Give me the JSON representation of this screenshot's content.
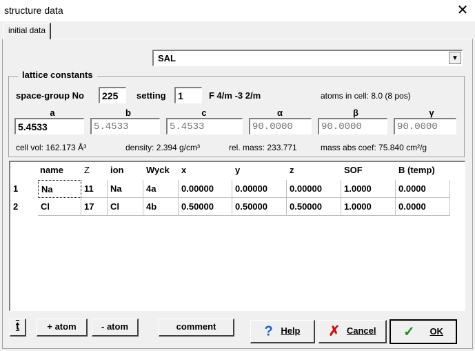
{
  "window": {
    "title": "structure data",
    "close_glyph": "✕"
  },
  "tabs": [
    {
      "label": "initial data"
    }
  ],
  "compound": {
    "value": "SAL",
    "arrow": "▼"
  },
  "lattice": {
    "label": "lattice constants",
    "space_group_label": "space-group No",
    "space_group_value": "225",
    "setting_label": "setting",
    "setting_value": "1",
    "hm_symbol": "F 4/m -3 2/m",
    "atoms_in_cell": "atoms in cell: 8.0  (8 pos)",
    "params": [
      {
        "label": "a",
        "value": "5.4533"
      },
      {
        "label": "b",
        "value": "5.4533"
      },
      {
        "label": "c",
        "value": "5.4533"
      },
      {
        "label": "α",
        "value": "90.0000"
      },
      {
        "label": "β",
        "value": "90.0000"
      },
      {
        "label": "γ",
        "value": "90.0000"
      }
    ],
    "cell_vol": "cell vol: 162.173 Å³",
    "density": "density: 2.394 g/cm³",
    "rel_mass": "rel. mass: 233.771",
    "mass_abs": "mass abs coef: 75.840 cm²/g"
  },
  "atoms": {
    "columns": [
      "name",
      "Z",
      "ion",
      "Wyck",
      "x",
      "y",
      "z",
      "SOF",
      "B (temp)"
    ],
    "rows": [
      {
        "num": "1",
        "cells": [
          "Na",
          "11",
          "Na",
          "4a",
          "0.00000",
          "0.00000",
          "0.00000",
          "1.0000",
          "0.0000"
        ]
      },
      {
        "num": "2",
        "cells": [
          "Cl",
          "17",
          "Cl",
          "4b",
          "0.50000",
          "0.50000",
          "0.50000",
          "1.0000",
          "0.0000"
        ]
      }
    ]
  },
  "buttons": {
    "sort_glyph": "t",
    "add_atom": "+ atom",
    "remove_atom": "- atom",
    "comment": "comment",
    "help_icon": "?",
    "help": "Help",
    "cancel_icon": "✗",
    "cancel": "Cancel",
    "ok_icon": "✓",
    "ok": "OK"
  },
  "colors": {
    "help_icon": "#1f5fbf",
    "cancel_icon": "#cc1010",
    "ok_icon": "#1c8a1c"
  }
}
